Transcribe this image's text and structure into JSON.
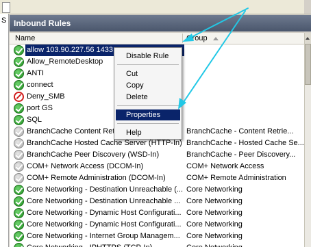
{
  "top": {
    "left_fragment": "S"
  },
  "panel": {
    "title": "Inbound Rules"
  },
  "columns": {
    "name": "Name",
    "group": "Group"
  },
  "rows": [
    {
      "icon": "allow-icon",
      "name": "allow 103.90.227.56 1433",
      "group": "",
      "selected": true
    },
    {
      "icon": "allow-icon",
      "name": "Allow_RemoteDesktop",
      "group": ""
    },
    {
      "icon": "allow-icon",
      "name": "ANTI",
      "group": ""
    },
    {
      "icon": "allow-icon",
      "name": "connect",
      "group": ""
    },
    {
      "icon": "deny-icon",
      "name": "Deny_SMB",
      "group": ""
    },
    {
      "icon": "allow-icon",
      "name": "port GS",
      "group": ""
    },
    {
      "icon": "allow-icon",
      "name": "SQL",
      "group": ""
    },
    {
      "icon": "disabled-icon",
      "name": "BranchCache Content Retri",
      "group": "BranchCache - Content Retrie..."
    },
    {
      "icon": "disabled-icon",
      "name": "BranchCache Hosted Cache Server (HTTP-In)",
      "group": "BranchCache - Hosted Cache Se..."
    },
    {
      "icon": "disabled-icon",
      "name": "BranchCache Peer Discovery (WSD-In)",
      "group": "BranchCache - Peer Discovery..."
    },
    {
      "icon": "disabled-icon",
      "name": "COM+ Network Access (DCOM-In)",
      "group": "COM+ Network Access"
    },
    {
      "icon": "disabled-icon",
      "name": "COM+ Remote Administration (DCOM-In)",
      "group": "COM+ Remote Administration"
    },
    {
      "icon": "allow-icon",
      "name": "Core Networking - Destination Unreachable (...",
      "group": "Core Networking"
    },
    {
      "icon": "allow-icon",
      "name": "Core Networking - Destination Unreachable ...",
      "group": "Core Networking"
    },
    {
      "icon": "allow-icon",
      "name": "Core Networking - Dynamic Host Configurati...",
      "group": "Core Networking"
    },
    {
      "icon": "allow-icon",
      "name": "Core Networking - Dynamic Host Configurati...",
      "group": "Core Networking"
    },
    {
      "icon": "allow-icon",
      "name": "Core Networking - Internet Group Managem...",
      "group": "Core Networking"
    },
    {
      "icon": "allow-icon",
      "name": "Core Networking - IPHTTPS (TCP-In)",
      "group": "Core Networking"
    }
  ],
  "context_menu": {
    "items": [
      {
        "label": "Disable Rule"
      },
      {
        "label": "Cut"
      },
      {
        "label": "Copy"
      },
      {
        "label": "Delete"
      },
      {
        "label": "Properties",
        "highlighted": true
      },
      {
        "label": "Help"
      }
    ]
  },
  "colors": {
    "selection": "#0a246a",
    "annotation_arrow": "#22c8e6",
    "header_bar": "#5a6780"
  }
}
